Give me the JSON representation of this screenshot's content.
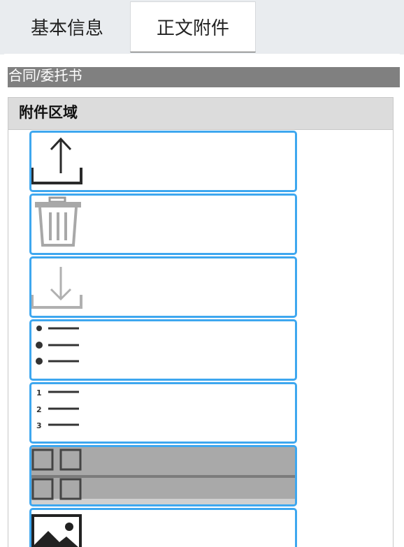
{
  "tabs": [
    {
      "label": "基本信息",
      "active": false
    },
    {
      "label": "正文附件",
      "active": true
    }
  ],
  "section": {
    "title": "合同/委托书"
  },
  "attachments": {
    "header": "附件区域",
    "tools": [
      {
        "icon": "upload-icon"
      },
      {
        "icon": "trash-icon"
      },
      {
        "icon": "download-icon"
      },
      {
        "icon": "bullet-list-icon"
      },
      {
        "icon": "numbered-list-icon"
      },
      {
        "icon": "table-icon"
      },
      {
        "icon": "image-icon"
      }
    ]
  },
  "colors": {
    "accent_border": "#3ea7ef",
    "section_bg": "#808080",
    "header_bg": "#dcdcdc",
    "tabbar_bg": "#e9ecef"
  }
}
